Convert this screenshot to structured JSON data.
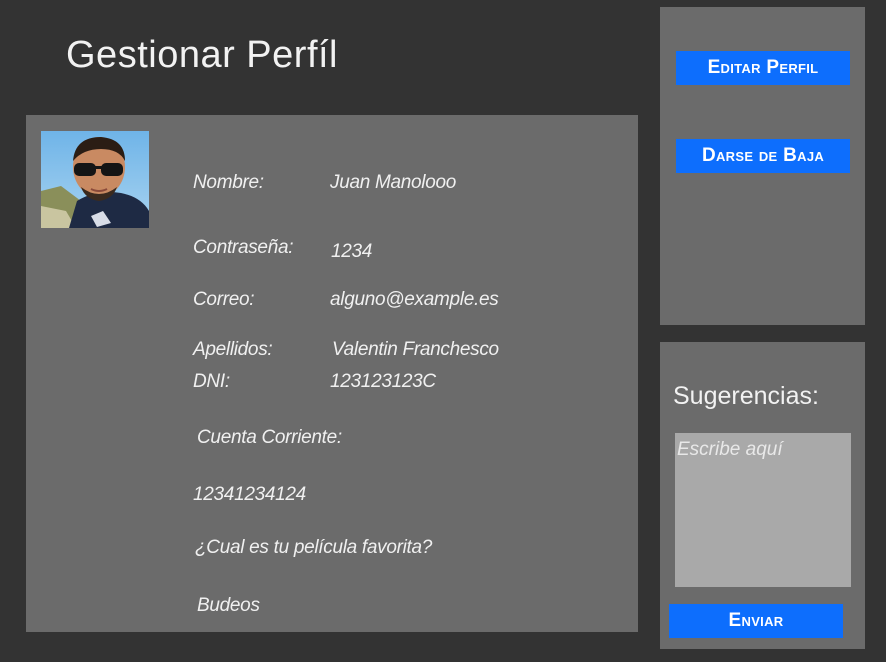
{
  "header": {
    "title": "Gestionar Perfíl"
  },
  "profile": {
    "nombre_label": "Nombre:",
    "nombre_value": "Juan Manolooo",
    "password_label": "Contraseña:",
    "password_value": "1234",
    "correo_label": "Correo:",
    "correo_value": "alguno@example.es",
    "apellidos_label": "Apellidos:",
    "apellidos_value": "Valentin Franchesco",
    "dni_label": "DNI:",
    "dni_value": "123123123C",
    "cuenta_label": "Cuenta Corriente:",
    "cuenta_value": "12341234124",
    "pregunta_label": "¿Cual es tu película favorita?",
    "pregunta_value": "Budeos"
  },
  "actions": {
    "editar_label": "Editar Perfil",
    "baja_label": "Darse de Baja"
  },
  "sugerencias": {
    "label": "Sugerencias:",
    "placeholder": "Escribe aquí",
    "enviar_label": "Enviar"
  },
  "colors": {
    "background": "#333333",
    "panel": "#6b6b6b",
    "button": "#0d6efd",
    "textarea": "#a9a9a9"
  }
}
